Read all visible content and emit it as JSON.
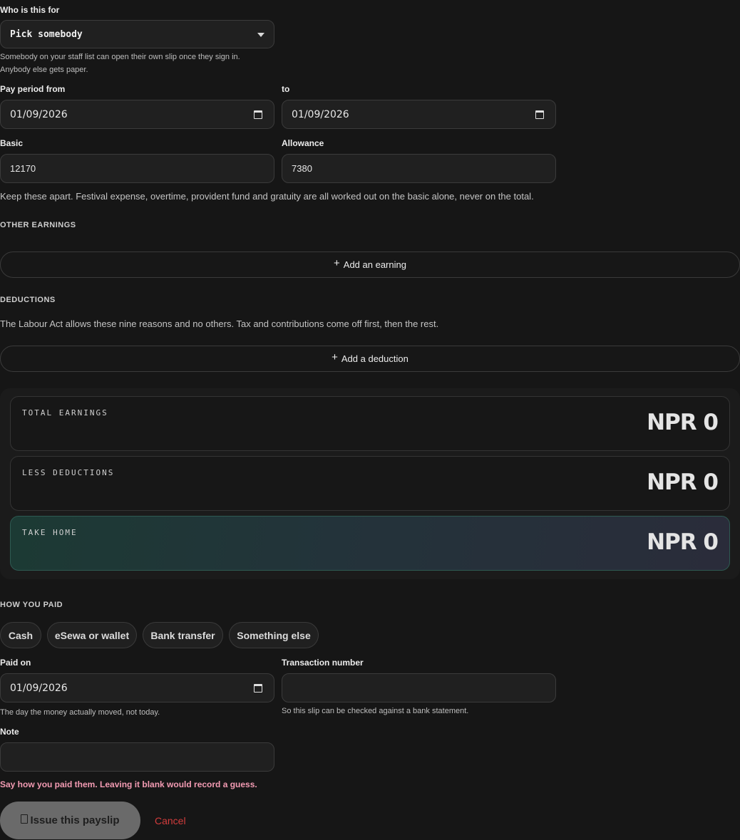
{
  "recipient": {
    "label": "Who is this for",
    "selected": "Pick somebody",
    "hint_line1": "Somebody on your staff list can open their own slip once they sign in.",
    "hint_line2": "Anybody else gets paper."
  },
  "period": {
    "from_label": "Pay period from",
    "from_value": "01/09/2026",
    "to_label": "to",
    "to_value": "01/09/2026"
  },
  "pay": {
    "basic_label": "Basic",
    "basic_value": "12170",
    "allowance_label": "Allowance",
    "allowance_value": "7380",
    "hint": "Keep these apart. Festival expense, overtime, provident fund and gratuity are all worked out on the basic alone, never on the total."
  },
  "earnings": {
    "heading": "OTHER EARNINGS",
    "add_label": "Add an earning"
  },
  "deductions": {
    "heading": "DEDUCTIONS",
    "hint": "The Labour Act allows these nine reasons and no others. Tax and contributions come off first, then the rest.",
    "add_label": "Add a deduction"
  },
  "totals": {
    "earnings_label": "TOTAL EARNINGS",
    "earnings_value": "NPR 0",
    "deductions_label": "LESS DEDUCTIONS",
    "deductions_value": "NPR 0",
    "take_home_label": "TAKE HOME",
    "take_home_value": "NPR 0"
  },
  "payment": {
    "heading": "HOW YOU PAID",
    "methods": [
      "Cash",
      "eSewa or wallet",
      "Bank transfer",
      "Something else"
    ],
    "paid_on_label": "Paid on",
    "paid_on_value": "01/09/2026",
    "paid_on_hint": "The day the money actually moved, not today.",
    "txn_label": "Transaction number",
    "txn_value": "",
    "txn_hint": "So this slip can be checked against a bank statement.",
    "note_label": "Note",
    "note_value": "",
    "error": "Say how you paid them. Leaving it blank would record a guess."
  },
  "actions": {
    "issue_label": "Issue this payslip",
    "cancel_label": "Cancel"
  },
  "icons": {
    "select": "chevron-down-icon",
    "date": "calendar-icon",
    "add": "plus-icon",
    "issue": "document-icon"
  }
}
